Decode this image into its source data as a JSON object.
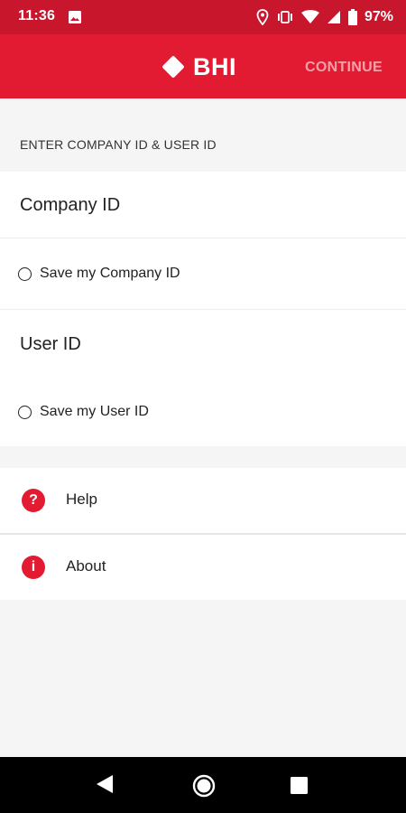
{
  "status_bar": {
    "time": "11:36",
    "battery": "97%",
    "icons": [
      "image-icon",
      "location-icon",
      "vibrate-icon",
      "wifi-icon",
      "signal-icon",
      "battery-icon"
    ]
  },
  "app_bar": {
    "logo_text": "BHI",
    "continue_label": "CONTINUE"
  },
  "form": {
    "section_title": "ENTER COMPANY ID & USER ID",
    "company_id_placeholder": "Company ID",
    "save_company_label": "Save my Company ID",
    "user_id_placeholder": "User ID",
    "save_user_label": "Save my User ID"
  },
  "menu": {
    "items": [
      {
        "label": "Help",
        "icon": "help-icon",
        "glyph": "?"
      },
      {
        "label": "About",
        "icon": "info-icon",
        "glyph": "i"
      }
    ]
  },
  "colors": {
    "brand_red": "#e31b32",
    "status_red": "#c8162c",
    "continue_disabled": "#f3a1a9"
  }
}
